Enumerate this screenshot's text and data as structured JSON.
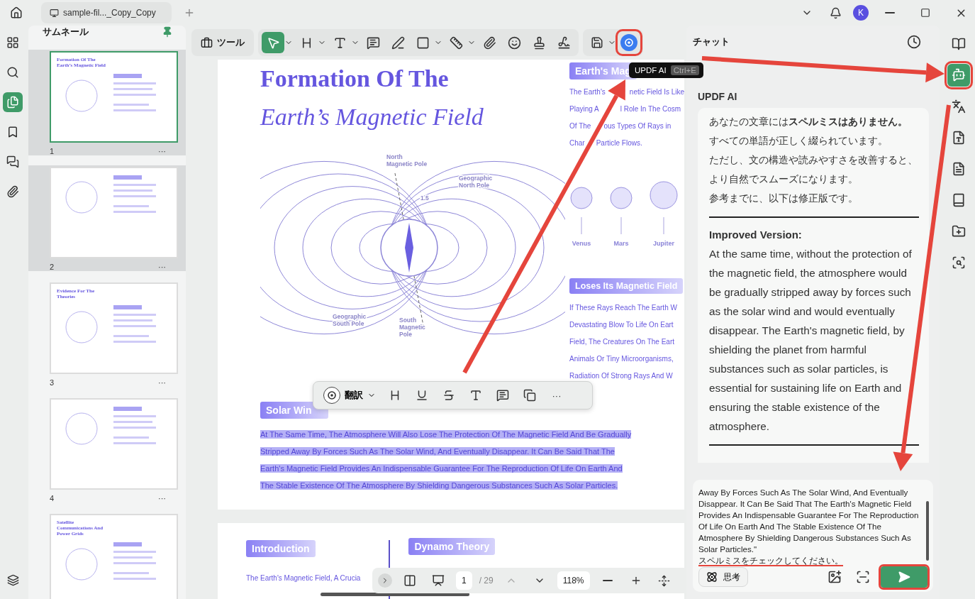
{
  "tabbar": {
    "tab": "sample-fil..._Copy_Copy",
    "avatar": "K"
  },
  "left_rail": [
    {
      "selected": false
    },
    {
      "selected": false
    },
    {
      "selected": true
    },
    {
      "selected": false
    },
    {
      "selected": false
    },
    {
      "selected": false
    },
    {
      "selected": false
    }
  ],
  "thumbnails": {
    "title": "サムネール",
    "pinned": true,
    "items": [
      {
        "page": "1",
        "selected": true,
        "in_view": true,
        "title": "Formation Of The Earth’s Magnetic Field",
        "more": "···"
      },
      {
        "page": "2",
        "selected": false,
        "in_view": true,
        "more": "···"
      },
      {
        "page": "3",
        "selected": false,
        "in_view": false,
        "title": "Evidence For The Theories",
        "more": "···"
      },
      {
        "page": "4",
        "selected": false,
        "in_view": false,
        "more": "···"
      },
      {
        "selected": false,
        "in_view": false,
        "title": "Satellite Communications And Power Grids"
      }
    ]
  },
  "toolbar": {
    "tools_button": "ツール",
    "tools": [
      {
        "selected": true,
        "caret": true
      },
      {
        "selected": false,
        "caret": true
      },
      {
        "selected": false,
        "caret": true
      },
      {
        "selected": false,
        "caret": false
      },
      {
        "selected": false,
        "caret": false
      },
      {
        "selected": false,
        "caret": true
      },
      {
        "selected": false,
        "caret": true
      },
      {
        "selected": false,
        "caret": false
      },
      {
        "selected": false,
        "caret": false
      },
      {
        "selected": false,
        "caret": false
      },
      {
        "selected": false,
        "caret": false
      }
    ],
    "extra": [
      {
        "caret": true,
        "outlined": false
      },
      {
        "caret": false,
        "outlined": true
      }
    ]
  },
  "tooltip": {
    "label": "UPDF AI",
    "shortcut": "Ctrl+E"
  },
  "page1": {
    "title": "Formation Of The",
    "subtitle": "Earth’s Magnetic Field",
    "diagram_labels": [
      {
        "lines": [
          "North",
          "Magnetic Pole"
        ]
      },
      {
        "lines": [
          "Geographic",
          "North Pole"
        ]
      },
      {
        "lines": [
          "1.5"
        ]
      },
      {
        "lines": [
          "Geographic",
          "South Pole"
        ]
      },
      {
        "lines": [
          "South",
          "Magnetic",
          "Pole"
        ]
      }
    ],
    "section1": {
      "heading": "Earth's Mag",
      "lines": [
        [
          "The Earth's",
          "netic Field Is Like"
        ],
        [
          "Playing A",
          "l Role In The Cosm"
        ],
        [
          "Of The",
          "ous Types Of Rays in"
        ],
        [
          "Char",
          "Particle Flows."
        ]
      ]
    },
    "planets": [
      "Venus",
      "Mars",
      "Jupiter"
    ],
    "section2": {
      "heading": "Loses Its Magnetic Field",
      "lines": [
        "If These Rays Reach The Earth W",
        "Devastating Blow To Life On Eart",
        "Field, The Creatures On The Eart",
        "Animals Or Tiny Microorganisms,",
        "Radiation Of Strong Rays And W"
      ]
    },
    "section3": {
      "heading": "Solar Win",
      "lines": [
        {
          "text": "At The Same Time, The Atmosphere Will Also Lose The Protection Of The Magnetic Field And Be Gradually",
          "selected": true
        },
        {
          "text": "Stripped Away By Forces Such As The Solar Wind, And Eventually Disappear. It Can Be Said That The",
          "selected": true
        },
        {
          "text": "Earth's Magnetic Field Provides An Indispensable Guarantee For The Reproduction Of Life On Earth And",
          "selected": true
        },
        {
          "text": "The Stable Existence Of The Atmosphere By Shielding Dangerous Substances Such As Solar Particles.",
          "selected": true
        }
      ]
    }
  },
  "page2": {
    "heading": "Introduction",
    "line": "The Earth's Magnetic Field, A Crucia",
    "heading2": "Dynamo Theory"
  },
  "selection_toolbar": {
    "translate": "翻訳",
    "more": "···"
  },
  "bottom_bar": {
    "page": "1",
    "total": "/ 29",
    "zoom": "118%"
  },
  "chat": {
    "title": "チャット",
    "sender": "UPDF AI",
    "reply_lines": [
      "あなたの文章には**スペルミスはありません。**",
      "すべての単語が正しく綴られています。",
      "ただし、文の構造や読みやすさを改善すると、",
      "より自然でスムーズになります。",
      "参考までに、以下は修正版です。"
    ],
    "improved_heading": "Improved Version:",
    "improved_text": "At the same time, without the protection of the magnetic field, the atmosphere would be gradually stripped away by forces such as the solar wind and would eventually disappear. The Earth's magnetic field, by shielding the planet from harmful substances such as solar particles, is essential for sustaining life on Earth and ensuring the stable existence of the atmosphere.",
    "input_lines": [
      {
        "text": "Away By Forces Such As The Solar Wind, And Eventually",
        "marked": false
      },
      {
        "text": "Disappear. It Can Be Said That The Earth's Magnetic Field",
        "marked": false
      },
      {
        "text": "Provides An Indispensable Guarantee For The Reproduction",
        "marked": false
      },
      {
        "text": "Of Life On Earth And The Stable Existence Of The",
        "marked": false
      },
      {
        "text": "Atmosphere By Shielding Dangerous Substances Such As",
        "marked": false
      },
      {
        "text": "Solar Particles.\"",
        "marked": false
      },
      {
        "text": "スペルミスをチェックしてください。",
        "marked": true
      }
    ],
    "think_button": "思考",
    "send_outlined": true
  },
  "right_rail": [
    {
      "selected": false,
      "outlined": false
    },
    {
      "selected": true,
      "outlined": true
    },
    {
      "selected": false,
      "outlined": false
    },
    {
      "selected": false,
      "outlined": false
    },
    {
      "selected": false,
      "outlined": false
    },
    {
      "selected": false,
      "outlined": false
    },
    {
      "selected": false,
      "outlined": false
    },
    {
      "selected": false,
      "outlined": false
    }
  ]
}
